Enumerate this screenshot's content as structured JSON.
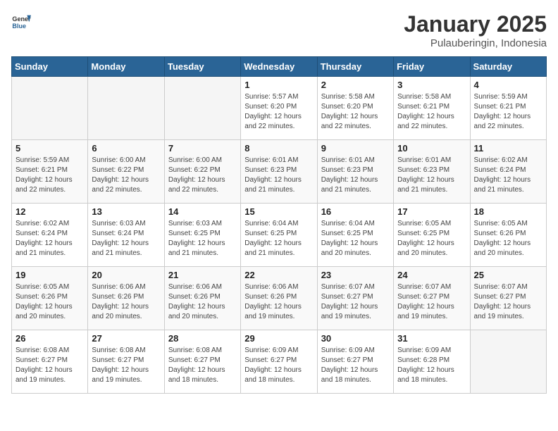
{
  "header": {
    "logo_general": "General",
    "logo_blue": "Blue",
    "title": "January 2025",
    "subtitle": "Pulauberingin, Indonesia"
  },
  "weekdays": [
    "Sunday",
    "Monday",
    "Tuesday",
    "Wednesday",
    "Thursday",
    "Friday",
    "Saturday"
  ],
  "weeks": [
    [
      {
        "day": "",
        "info": ""
      },
      {
        "day": "",
        "info": ""
      },
      {
        "day": "",
        "info": ""
      },
      {
        "day": "1",
        "info": "Sunrise: 5:57 AM\nSunset: 6:20 PM\nDaylight: 12 hours\nand 22 minutes."
      },
      {
        "day": "2",
        "info": "Sunrise: 5:58 AM\nSunset: 6:20 PM\nDaylight: 12 hours\nand 22 minutes."
      },
      {
        "day": "3",
        "info": "Sunrise: 5:58 AM\nSunset: 6:21 PM\nDaylight: 12 hours\nand 22 minutes."
      },
      {
        "day": "4",
        "info": "Sunrise: 5:59 AM\nSunset: 6:21 PM\nDaylight: 12 hours\nand 22 minutes."
      }
    ],
    [
      {
        "day": "5",
        "info": "Sunrise: 5:59 AM\nSunset: 6:21 PM\nDaylight: 12 hours\nand 22 minutes."
      },
      {
        "day": "6",
        "info": "Sunrise: 6:00 AM\nSunset: 6:22 PM\nDaylight: 12 hours\nand 22 minutes."
      },
      {
        "day": "7",
        "info": "Sunrise: 6:00 AM\nSunset: 6:22 PM\nDaylight: 12 hours\nand 22 minutes."
      },
      {
        "day": "8",
        "info": "Sunrise: 6:01 AM\nSunset: 6:23 PM\nDaylight: 12 hours\nand 21 minutes."
      },
      {
        "day": "9",
        "info": "Sunrise: 6:01 AM\nSunset: 6:23 PM\nDaylight: 12 hours\nand 21 minutes."
      },
      {
        "day": "10",
        "info": "Sunrise: 6:01 AM\nSunset: 6:23 PM\nDaylight: 12 hours\nand 21 minutes."
      },
      {
        "day": "11",
        "info": "Sunrise: 6:02 AM\nSunset: 6:24 PM\nDaylight: 12 hours\nand 21 minutes."
      }
    ],
    [
      {
        "day": "12",
        "info": "Sunrise: 6:02 AM\nSunset: 6:24 PM\nDaylight: 12 hours\nand 21 minutes."
      },
      {
        "day": "13",
        "info": "Sunrise: 6:03 AM\nSunset: 6:24 PM\nDaylight: 12 hours\nand 21 minutes."
      },
      {
        "day": "14",
        "info": "Sunrise: 6:03 AM\nSunset: 6:25 PM\nDaylight: 12 hours\nand 21 minutes."
      },
      {
        "day": "15",
        "info": "Sunrise: 6:04 AM\nSunset: 6:25 PM\nDaylight: 12 hours\nand 21 minutes."
      },
      {
        "day": "16",
        "info": "Sunrise: 6:04 AM\nSunset: 6:25 PM\nDaylight: 12 hours\nand 20 minutes."
      },
      {
        "day": "17",
        "info": "Sunrise: 6:05 AM\nSunset: 6:25 PM\nDaylight: 12 hours\nand 20 minutes."
      },
      {
        "day": "18",
        "info": "Sunrise: 6:05 AM\nSunset: 6:26 PM\nDaylight: 12 hours\nand 20 minutes."
      }
    ],
    [
      {
        "day": "19",
        "info": "Sunrise: 6:05 AM\nSunset: 6:26 PM\nDaylight: 12 hours\nand 20 minutes."
      },
      {
        "day": "20",
        "info": "Sunrise: 6:06 AM\nSunset: 6:26 PM\nDaylight: 12 hours\nand 20 minutes."
      },
      {
        "day": "21",
        "info": "Sunrise: 6:06 AM\nSunset: 6:26 PM\nDaylight: 12 hours\nand 20 minutes."
      },
      {
        "day": "22",
        "info": "Sunrise: 6:06 AM\nSunset: 6:26 PM\nDaylight: 12 hours\nand 19 minutes."
      },
      {
        "day": "23",
        "info": "Sunrise: 6:07 AM\nSunset: 6:27 PM\nDaylight: 12 hours\nand 19 minutes."
      },
      {
        "day": "24",
        "info": "Sunrise: 6:07 AM\nSunset: 6:27 PM\nDaylight: 12 hours\nand 19 minutes."
      },
      {
        "day": "25",
        "info": "Sunrise: 6:07 AM\nSunset: 6:27 PM\nDaylight: 12 hours\nand 19 minutes."
      }
    ],
    [
      {
        "day": "26",
        "info": "Sunrise: 6:08 AM\nSunset: 6:27 PM\nDaylight: 12 hours\nand 19 minutes."
      },
      {
        "day": "27",
        "info": "Sunrise: 6:08 AM\nSunset: 6:27 PM\nDaylight: 12 hours\nand 19 minutes."
      },
      {
        "day": "28",
        "info": "Sunrise: 6:08 AM\nSunset: 6:27 PM\nDaylight: 12 hours\nand 18 minutes."
      },
      {
        "day": "29",
        "info": "Sunrise: 6:09 AM\nSunset: 6:27 PM\nDaylight: 12 hours\nand 18 minutes."
      },
      {
        "day": "30",
        "info": "Sunrise: 6:09 AM\nSunset: 6:27 PM\nDaylight: 12 hours\nand 18 minutes."
      },
      {
        "day": "31",
        "info": "Sunrise: 6:09 AM\nSunset: 6:28 PM\nDaylight: 12 hours\nand 18 minutes."
      },
      {
        "day": "",
        "info": ""
      }
    ]
  ]
}
